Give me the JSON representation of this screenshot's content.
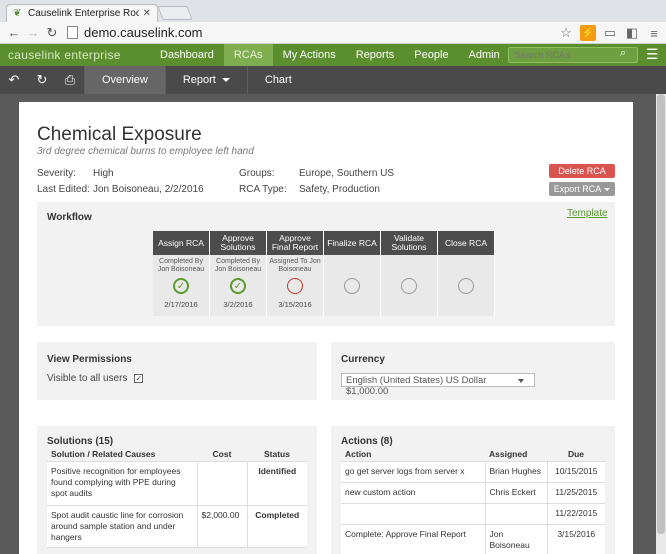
{
  "browser": {
    "tab_title": "Causelink Enterprise Root",
    "url": "demo.causelink.com"
  },
  "app": {
    "brand": "causelink enterprise",
    "nav": [
      {
        "label": "Dashboard",
        "active": false
      },
      {
        "label": "RCAs",
        "active": true
      },
      {
        "label": "My Actions",
        "active": false
      },
      {
        "label": "Reports",
        "active": false
      },
      {
        "label": "People",
        "active": false
      },
      {
        "label": "Admin",
        "active": false
      }
    ],
    "search_placeholder": "Search RCAs"
  },
  "subnav": {
    "tabs": [
      {
        "label": "Overview",
        "active": true
      },
      {
        "label": "Report",
        "active": false
      },
      {
        "label": "Chart",
        "active": false
      }
    ]
  },
  "rca": {
    "title": "Chemical Exposure",
    "subtitle": "3rd degree chemical burns to employee left hand",
    "severity_label": "Severity:",
    "severity": "High",
    "edited_label": "Last Edited:",
    "edited": "Jon Boisoneau, 2/2/2016",
    "groups_label": "Groups:",
    "groups": "Europe, Southern US",
    "type_label": "RCA Type:",
    "type": "Safety, Production",
    "delete_label": "Delete RCA",
    "export_label": "Export RCA"
  },
  "workflow": {
    "title": "Workflow",
    "template_link": "Template",
    "steps": [
      {
        "name": "Assign RCA",
        "note": "Completed By Jon Boisoneau",
        "status": "done",
        "date": "2/17/2016"
      },
      {
        "name": "Approve Solutions",
        "note": "Completed By Jon Boisoneau",
        "status": "done",
        "date": "3/2/2016"
      },
      {
        "name": "Approve Final Report",
        "note": "Assigned To Jon Boisoneau",
        "status": "pending",
        "date": "3/15/2016"
      },
      {
        "name": "Finalize RCA",
        "note": "",
        "status": "empty",
        "date": ""
      },
      {
        "name": "Validate Solutions",
        "note": "",
        "status": "empty",
        "date": ""
      },
      {
        "name": "Close RCA",
        "note": "",
        "status": "empty",
        "date": ""
      }
    ]
  },
  "permissions": {
    "title": "View Permissions",
    "label": "Visible to all users"
  },
  "currency": {
    "title": "Currency",
    "selected": "English (United States) US Dollar $1,000.00"
  },
  "solutions": {
    "title": "Solutions (15)",
    "headers": [
      "Solution / Related Causes",
      "Cost",
      "Status"
    ],
    "rows": [
      {
        "text": "Positive recognition for employees found complying with PPE during spot audits",
        "cost": "",
        "status": "Identified"
      },
      {
        "text": "Spot audit caustic line for corrosion around sample station and under hangers",
        "cost": "$2,000.00",
        "status": "Completed"
      }
    ]
  },
  "actions": {
    "title": "Actions (8)",
    "headers": [
      "Action",
      "Assigned",
      "Due"
    ],
    "rows": [
      {
        "action": "go get server logs from server x",
        "assigned": "Brian Hughes",
        "due": "10/15/2015"
      },
      {
        "action": "new custom action",
        "assigned": "Chris Eckert",
        "due": "11/25/2015"
      },
      {
        "action": "",
        "assigned": "",
        "due": "11/22/2015"
      },
      {
        "action": "Complete: Approve Final Report",
        "assigned": "Jon Boisoneau",
        "due": "3/15/2016"
      }
    ]
  }
}
